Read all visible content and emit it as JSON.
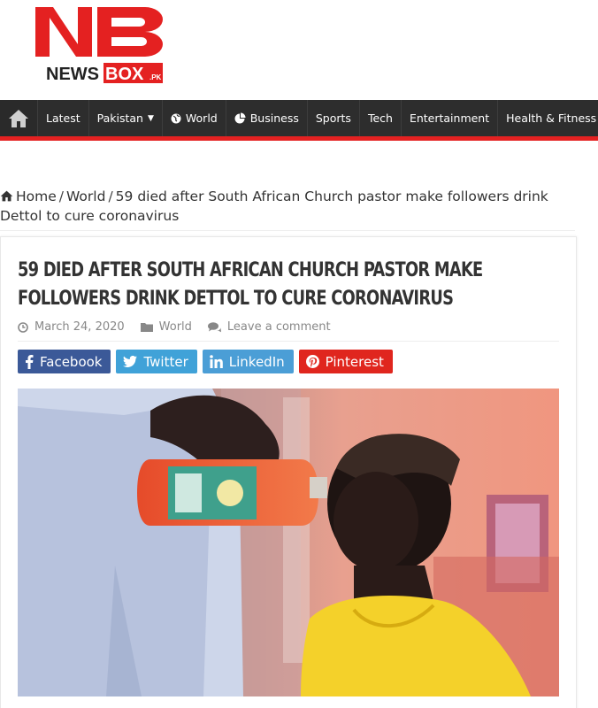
{
  "logo": {
    "letters": "NB",
    "word1": "NEWS",
    "word2": "BOX",
    "suffix": ".PK"
  },
  "nav": {
    "items": [
      {
        "label": "Latest"
      },
      {
        "label": "Pakistan"
      },
      {
        "label": "World"
      },
      {
        "label": "Business"
      },
      {
        "label": "Sports"
      },
      {
        "label": "Tech"
      },
      {
        "label": "Entertainment"
      },
      {
        "label": "Health & Fitness"
      }
    ]
  },
  "breadcrumb": {
    "home": "Home",
    "sep": "/",
    "section": "World",
    "current": "59 died after South African Church pastor make followers drink Dettol to cure coronavirus"
  },
  "article": {
    "title": "59 died after South African Church pastor make followers drink Dettol to cure coronavirus",
    "date": "March 24, 2020",
    "category": "World",
    "comment": "Leave a comment"
  },
  "share": {
    "facebook": "Facebook",
    "twitter": "Twitter",
    "linkedin": "LinkedIn",
    "pinterest": "Pinterest"
  },
  "colors": {
    "nav_bg": "#2d2d2d",
    "accent_red": "#e42121",
    "facebook": "#3b5998",
    "twitter": "#40a2d8",
    "linkedin": "#4b9ed6",
    "pinterest": "#e0261e"
  },
  "icons": {
    "nav_home": "home-icon",
    "world": "globe-icon",
    "business": "pie-chart-icon",
    "date": "clock-icon",
    "category": "folder-icon",
    "comment": "comments-icon"
  }
}
